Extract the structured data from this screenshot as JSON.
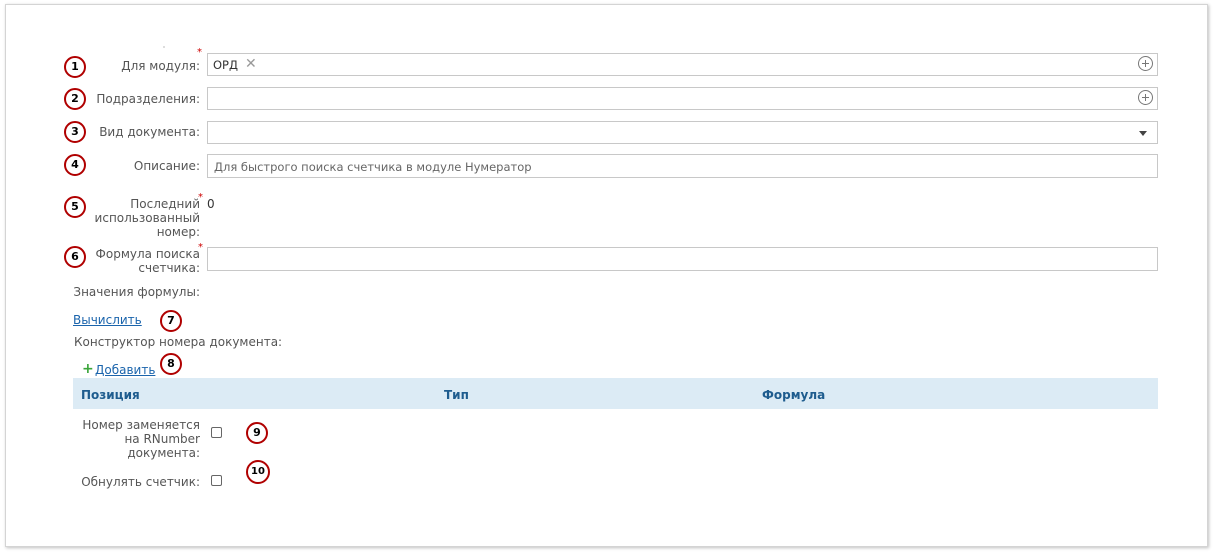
{
  "form": {
    "module": {
      "label": "Для модуля:",
      "tag": "ОРД",
      "tag_remove": "✕"
    },
    "divisions": {
      "label": "Подразделения:"
    },
    "doc_type": {
      "label": "Вид документа:"
    },
    "description": {
      "label": "Описание:",
      "placeholder": "Для быстрого поиска счетчика в модуле Нумератор"
    },
    "last_number": {
      "label_line1": "Последний",
      "label_line2": "использованный",
      "label_line3": "номер:",
      "value": "0"
    },
    "search_formula": {
      "label_line1": "Формула поиска",
      "label_line2": "счетчика:"
    },
    "formula_values": {
      "label": "Значения формулы:"
    },
    "calculate_link": "Вычислить",
    "constructor_label": "Конструктор номера документа:",
    "add_link": "Добавить",
    "add_plus": "+",
    "required_mark": "*",
    "table": {
      "columns": [
        "Позиция",
        "Тип",
        "Формула"
      ]
    },
    "replace_rnumber": {
      "label_line1": "Номер заменяется",
      "label_line2": "на RNumber",
      "label_line3": "документа:"
    },
    "reset_counter": {
      "label": "Обнулять счетчик:"
    }
  },
  "badges": [
    "1",
    "2",
    "3",
    "4",
    "5",
    "6",
    "7",
    "8",
    "9",
    "10"
  ],
  "colors": {
    "badge_border": "#b00000",
    "link": "#1a64ac",
    "table_header_bg": "#dcebf5",
    "table_header_text": "#1e5c8e",
    "required": "#cc0000",
    "add_plus": "#3aa53a"
  },
  "icons": {
    "add_circle": "plus-circle-icon",
    "dropdown": "caret-down-icon",
    "remove_tag": "close-icon",
    "add": "plus-icon"
  }
}
